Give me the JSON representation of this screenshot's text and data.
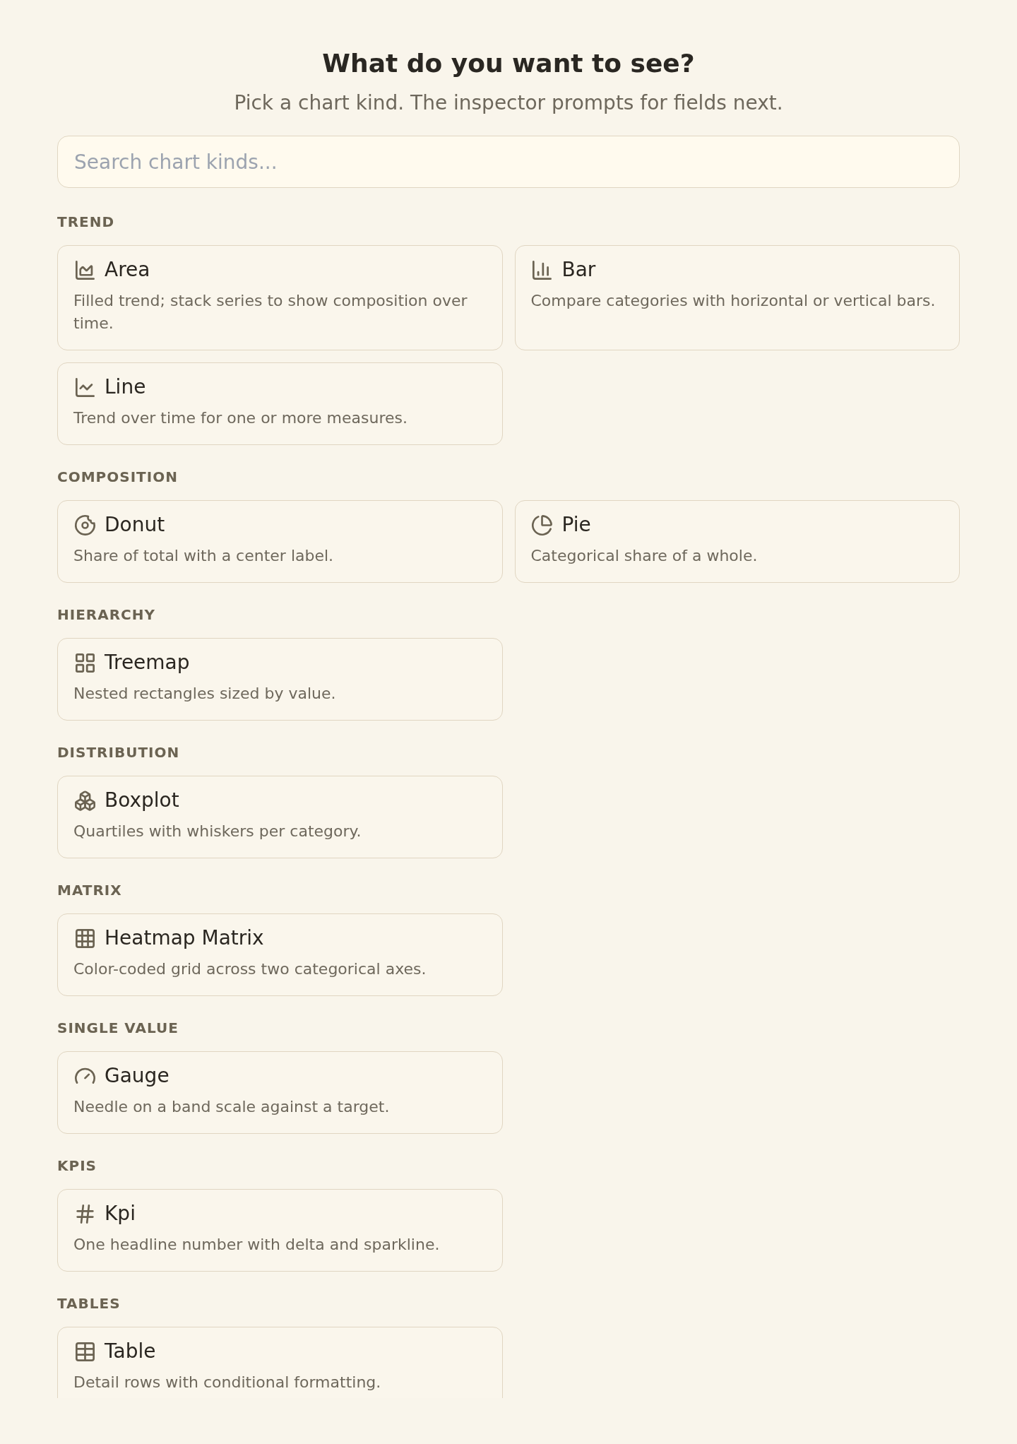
{
  "header": {
    "title": "What do you want to see?",
    "subtitle": "Pick a chart kind. The inspector prompts for fields next."
  },
  "search": {
    "placeholder": "Search chart kinds..."
  },
  "sections": [
    {
      "heading": "TREND",
      "items": [
        {
          "kind": "area",
          "name": "Area",
          "description": "Filled trend; stack series to show composition over time."
        },
        {
          "kind": "bar",
          "name": "Bar",
          "description": "Compare categories with horizontal or vertical bars."
        },
        {
          "kind": "line",
          "name": "Line",
          "description": "Trend over time for one or more measures."
        }
      ]
    },
    {
      "heading": "COMPOSITION",
      "items": [
        {
          "kind": "donut",
          "name": "Donut",
          "description": "Share of total with a center label."
        },
        {
          "kind": "pie",
          "name": "Pie",
          "description": "Categorical share of a whole."
        }
      ]
    },
    {
      "heading": "HIERARCHY",
      "items": [
        {
          "kind": "treemap",
          "name": "Treemap",
          "description": "Nested rectangles sized by value."
        }
      ]
    },
    {
      "heading": "DISTRIBUTION",
      "items": [
        {
          "kind": "boxplot",
          "name": "Boxplot",
          "description": "Quartiles with whiskers per category."
        }
      ]
    },
    {
      "heading": "MATRIX",
      "items": [
        {
          "kind": "heatmap",
          "name": "Heatmap Matrix",
          "description": "Color-coded grid across two categorical axes."
        }
      ]
    },
    {
      "heading": "SINGLE VALUE",
      "items": [
        {
          "kind": "gauge",
          "name": "Gauge",
          "description": "Needle on a band scale against a target."
        }
      ]
    },
    {
      "heading": "KPIS",
      "items": [
        {
          "kind": "kpi",
          "name": "Kpi",
          "description": "One headline number with delta and sparkline."
        }
      ]
    },
    {
      "heading": "TABLES",
      "items": [
        {
          "kind": "table",
          "name": "Table",
          "description": "Detail rows with conditional formatting."
        }
      ]
    }
  ]
}
